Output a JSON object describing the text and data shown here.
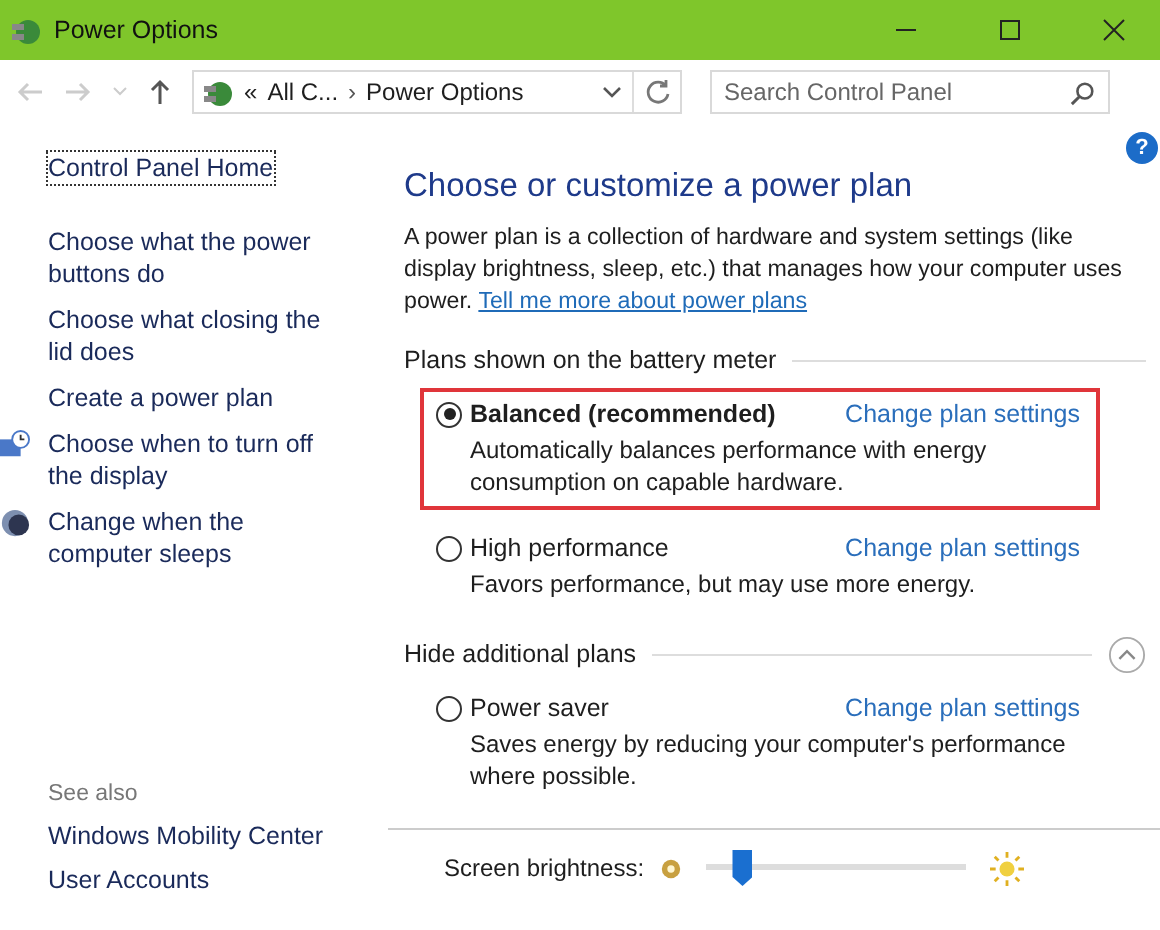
{
  "window": {
    "title": "Power Options"
  },
  "address_bar": {
    "prefix": "«",
    "crumbs": [
      "All C...",
      "Power Options"
    ],
    "separator": "›"
  },
  "search": {
    "placeholder": "Search Control Panel"
  },
  "help": {
    "label": "?"
  },
  "sidebar": {
    "items": [
      {
        "label": "Control Panel Home",
        "kind": "home"
      },
      {
        "label": "Choose what the power buttons do",
        "kind": "link"
      },
      {
        "label": "Choose what closing the lid does",
        "kind": "link"
      },
      {
        "label": "Create a power plan",
        "kind": "link"
      },
      {
        "label": "Choose when to turn off the display",
        "kind": "display"
      },
      {
        "label": "Change when the computer sleeps",
        "kind": "sleep"
      }
    ],
    "see_also": {
      "title": "See also",
      "items": [
        "Windows Mobility Center",
        "User Accounts"
      ]
    }
  },
  "main": {
    "heading": "Choose or customize a power plan",
    "intro": "A power plan is a collection of hardware and system settings (like display brightness, sleep, etc.) that manages how your computer uses power.",
    "intro_link": "Tell me more about power plans",
    "groups": [
      {
        "title": "Plans shown on the battery meter",
        "expander": false,
        "plans": [
          {
            "name": "Balanced (recommended)",
            "selected": true,
            "highlighted": true,
            "link": "Change plan settings",
            "description": "Automatically balances performance with energy consumption on capable hardware."
          },
          {
            "name": "High performance",
            "selected": false,
            "highlighted": false,
            "link": "Change plan settings",
            "description": "Favors performance, but may use more energy."
          }
        ]
      },
      {
        "title": "Hide additional plans",
        "expander": true,
        "plans": [
          {
            "name": "Power saver",
            "selected": false,
            "highlighted": false,
            "link": "Change plan settings",
            "description": "Saves energy by reducing your computer's performance where possible."
          }
        ]
      }
    ]
  },
  "brightness": {
    "label": "Screen brightness:",
    "level": 0.14
  }
}
